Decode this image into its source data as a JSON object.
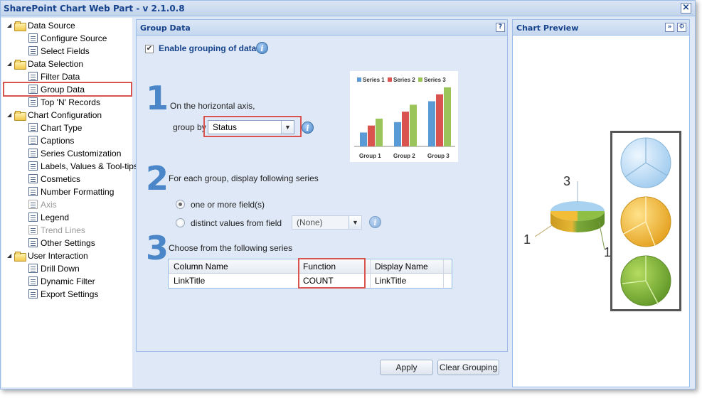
{
  "window": {
    "title": "SharePoint Chart Web Part - v 2.1.0.8"
  },
  "tree": [
    {
      "label": "Data Source",
      "type": "folder"
    },
    {
      "label": "Configure Source",
      "type": "leaf"
    },
    {
      "label": "Select Fields",
      "type": "leaf"
    },
    {
      "label": "Data Selection",
      "type": "folder"
    },
    {
      "label": "Filter Data",
      "type": "leaf"
    },
    {
      "label": "Group Data",
      "type": "leaf",
      "selected": true
    },
    {
      "label": "Top 'N' Records",
      "type": "leaf"
    },
    {
      "label": "Chart Configuration",
      "type": "folder"
    },
    {
      "label": "Chart Type",
      "type": "leaf"
    },
    {
      "label": "Captions",
      "type": "leaf"
    },
    {
      "label": "Series Customization",
      "type": "leaf"
    },
    {
      "label": "Labels, Values & Tool-tips",
      "type": "leaf"
    },
    {
      "label": "Cosmetics",
      "type": "leaf"
    },
    {
      "label": "Number Formatting",
      "type": "leaf"
    },
    {
      "label": "Axis",
      "type": "leaf",
      "disabled": true
    },
    {
      "label": "Legend",
      "type": "leaf"
    },
    {
      "label": "Trend Lines",
      "type": "leaf",
      "disabled": true
    },
    {
      "label": "Other Settings",
      "type": "leaf"
    },
    {
      "label": "User Interaction",
      "type": "folder"
    },
    {
      "label": "Drill Down",
      "type": "leaf"
    },
    {
      "label": "Dynamic Filter",
      "type": "leaf"
    },
    {
      "label": "Export Settings",
      "type": "leaf"
    }
  ],
  "group_panel": {
    "title": "Group Data",
    "help": "?",
    "enable_label": "Enable grouping of data",
    "step1_num": "1",
    "step1_text": "On the horizontal axis,",
    "group_by_label": "group by",
    "group_by_value": "Status",
    "step2_num": "2",
    "step2_text": "For each group, display following series",
    "radio1": "one or more field(s)",
    "radio2": "distinct values from field",
    "distinct_value": "(None)",
    "step3_num": "3",
    "step3_text": "Choose from the following series",
    "columns": [
      "Column Name",
      "Function",
      "Display Name"
    ],
    "rows": [
      [
        "LinkTitle",
        "COUNT",
        "LinkTitle"
      ]
    ],
    "apply": "Apply",
    "clear": "Clear Grouping"
  },
  "sample_chart": {
    "legend": [
      "Series 1",
      "Series 2",
      "Series 3"
    ],
    "colors": [
      "#5b9bd5",
      "#d9534f",
      "#9bc55a"
    ],
    "groups": [
      "Group 1",
      "Group 2",
      "Group 3"
    ],
    "values": [
      [
        2,
        3,
        4
      ],
      [
        3.5,
        5,
        6
      ],
      [
        6.5,
        7.5,
        8.5
      ]
    ]
  },
  "preview_panel": {
    "title": "Chart Preview",
    "pie_labels": [
      "3",
      "1",
      "1"
    ]
  },
  "colors": {
    "header_text": "#15428b",
    "accent": "#4a86c8",
    "highlight": "#d9534f"
  }
}
